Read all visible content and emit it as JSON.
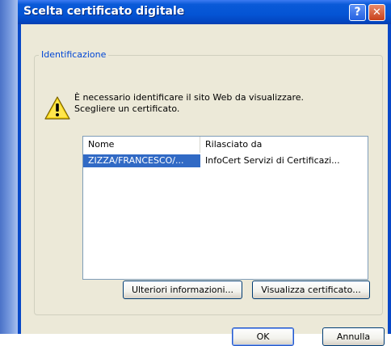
{
  "window": {
    "title": "Scelta certificato digitale",
    "help_label": "?",
    "close_label": "✕"
  },
  "identification": {
    "legend": "Identificazione",
    "icon": "warning-icon",
    "message_line1": "È necessario identificare il sito Web da visualizzare.",
    "message_line2": "Scegliere un certificato."
  },
  "certificates": {
    "columns": [
      "Nome",
      "Rilasciato da"
    ],
    "rows": [
      {
        "name": "ZIZZA/FRANCESCO/...",
        "issuer": "InfoCert Servizi di Certificazi...",
        "selected": true
      }
    ]
  },
  "buttons": {
    "more_info": "Ulteriori informazioni...",
    "view_certificate": "Visualizza certificato...",
    "ok": "OK",
    "cancel": "Annulla"
  },
  "colors": {
    "titlebar": "#0454d4",
    "selection": "#316ac5",
    "legend": "#0046d5",
    "dialog_bg": "#ece9d8"
  }
}
